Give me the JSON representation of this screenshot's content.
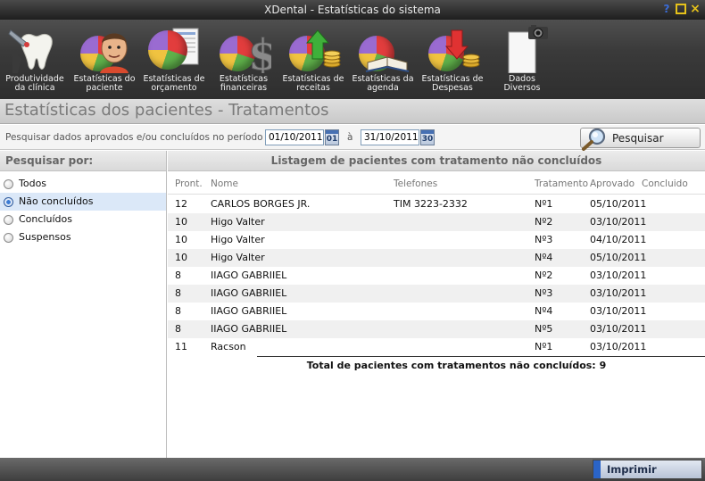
{
  "window": {
    "title": "XDental - Estatísticas do sistema",
    "help": "?",
    "maximize": "",
    "close": "×"
  },
  "toolbar": {
    "items": [
      {
        "label": "Produtividade\nda clínica",
        "icon": "tooth-drill-icon"
      },
      {
        "label": "Estatísticas do\npaciente",
        "icon": "patient-pie-icon"
      },
      {
        "label": "Estatísticas de\norçamento",
        "icon": "budget-pie-icon"
      },
      {
        "label": "Estatísticas\nfinanceiras",
        "icon": "dollar-pie-icon"
      },
      {
        "label": "Estatísticas de\nreceitas",
        "icon": "revenue-pie-icon"
      },
      {
        "label": "Estatísticas da\nagenda",
        "icon": "agenda-pie-icon"
      },
      {
        "label": "Estatísticas de\nDespesas",
        "icon": "expenses-pie-icon"
      },
      {
        "label": "Dados\nDiversos",
        "icon": "camera-document-icon"
      }
    ]
  },
  "page": {
    "title": "Estatísticas dos pacientes - Tratamentos"
  },
  "search": {
    "label": "Pesquisar dados aprovados e/ou concluídos no período de:",
    "date_from": "01/10/2011",
    "cal_from_label": "01",
    "separator": "à",
    "date_to": "31/10/2011",
    "cal_to_label": "30",
    "button_label": "Pesquisar"
  },
  "filter": {
    "header": "Pesquisar por:",
    "options": [
      "Todos",
      "Não concluídos",
      "Concluídos",
      "Suspensos"
    ],
    "selected": "Não concluídos"
  },
  "listing": {
    "header": "Listagem de pacientes com tratamento não concluídos",
    "columns": [
      "Pront.",
      "Nome",
      "Telefones",
      "Tratamento",
      "Aprovado",
      "Concluido"
    ],
    "rows": [
      [
        "12",
        "CARLOS BORGES JR.",
        "TIM 3223-2332",
        "Nº1",
        "05/10/2011",
        ""
      ],
      [
        "10",
        "Higo Valter",
        "",
        "Nº2",
        "03/10/2011",
        ""
      ],
      [
        "10",
        "Higo Valter",
        "",
        "Nº3",
        "04/10/2011",
        ""
      ],
      [
        "10",
        "Higo Valter",
        "",
        "Nº4",
        "05/10/2011",
        ""
      ],
      [
        "8",
        "IIAGO GABRIIEL",
        "",
        "Nº2",
        "03/10/2011",
        ""
      ],
      [
        "8",
        "IIAGO GABRIIEL",
        "",
        "Nº3",
        "03/10/2011",
        ""
      ],
      [
        "8",
        "IIAGO GABRIIEL",
        "",
        "Nº4",
        "03/10/2011",
        ""
      ],
      [
        "8",
        "IIAGO GABRIIEL",
        "",
        "Nº5",
        "03/10/2011",
        ""
      ],
      [
        "11",
        "Racson",
        "",
        "Nº1",
        "03/10/2011",
        ""
      ]
    ],
    "total_label": "Total de pacientes com tratamentos não concluídos:",
    "total_value": "9"
  },
  "footer": {
    "print_label": "Imprimir"
  },
  "colors": {
    "accent": "#2a64c8",
    "selected_row": "#dbe8f8",
    "titlebar": "#2a2a2a"
  }
}
